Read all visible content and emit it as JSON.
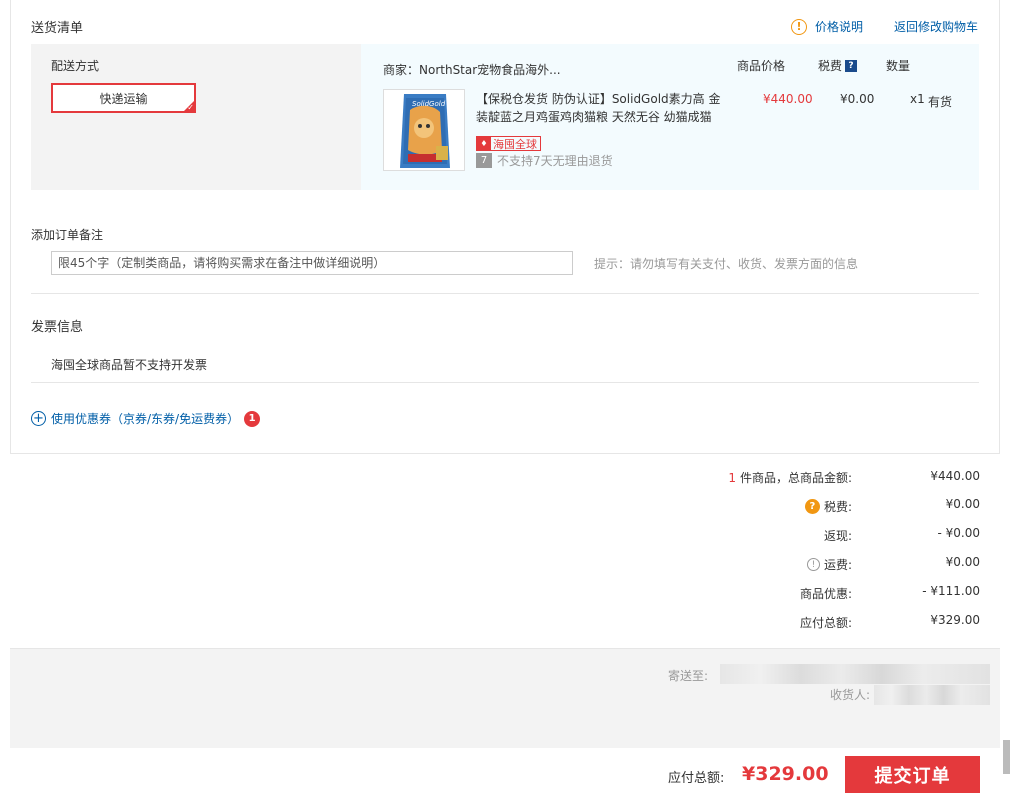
{
  "delivery": {
    "title": "送货清单",
    "price_info_label": "价格说明",
    "back_to_cart_label": "返回修改购物车",
    "shipping_method_title": "配送方式",
    "shipping_option": "快递运输"
  },
  "goods": {
    "merchant": "商家：NorthStar宠物食品海外...",
    "col_price": "商品价格",
    "col_tax": "税费",
    "col_qty": "数量",
    "thumb_brand": "SolidGold",
    "item": {
      "title_line1": "【保税仓发货 防伪认证】SolidGold素力高 金",
      "title_line2": "装靛蓝之月鸡蛋鸡肉猫粮 天然无谷 幼猫成猫",
      "price": "¥440.00",
      "tax": "¥0.00",
      "qty": "x1",
      "stock": "有货",
      "badge": "海囤全球",
      "no_return_num": "7",
      "no_return": "不支持7天无理由退货"
    }
  },
  "remark": {
    "title": "添加订单备注",
    "placeholder": "限45个字（定制类商品，请将购买需求在备注中做详细说明）",
    "tip": "提示：请勿填写有关支付、收货、发票方面的信息"
  },
  "invoice": {
    "title": "发票信息",
    "note": "海囤全球商品暂不支持开发票"
  },
  "coupon": {
    "label": "使用优惠券（京券/东券/免运费券）",
    "count": "1"
  },
  "summary": {
    "item_count": "1",
    "item_count_suffix": "件商品，总商品金额:",
    "total_goods": "¥440.00",
    "tax_label": "税费:",
    "tax": "¥0.00",
    "cashback_label": "返现:",
    "cashback": "- ¥0.00",
    "freight_label": "运费:",
    "freight": "¥0.00",
    "discount_label": "商品优惠:",
    "discount": "- ¥111.00",
    "payable_label": "应付总额:",
    "payable": "¥329.00"
  },
  "address": {
    "ship_to_label": "寄送至:",
    "receiver_label": "收货人:"
  },
  "footer": {
    "payable_label": "应付总额:",
    "payable": "¥329.00",
    "submit_label": "提交订单"
  },
  "colors": {
    "accent": "#e4393c",
    "link": "#005ea7",
    "warning": "#f19712"
  }
}
